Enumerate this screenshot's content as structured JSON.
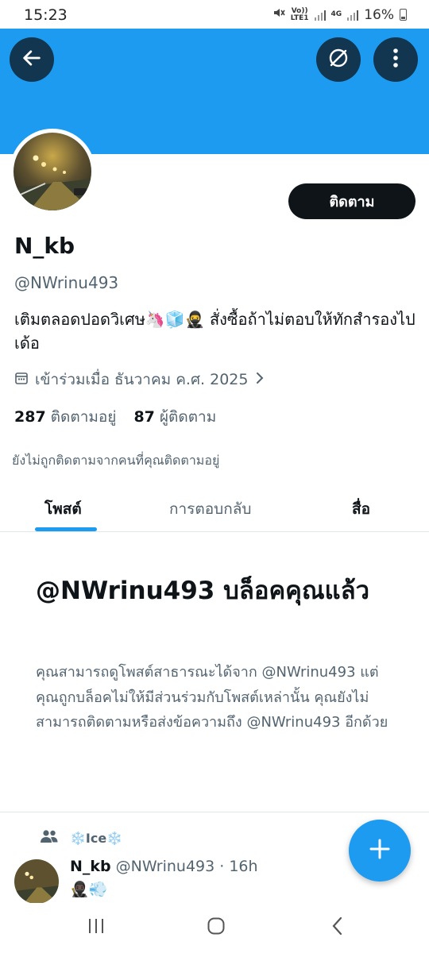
{
  "colors": {
    "banner": "#1d9bf0",
    "accent": "#1d9bf0",
    "text_primary": "#0f1419",
    "text_secondary": "#536471"
  },
  "status_bar": {
    "time": "15:23",
    "volte_top": "Vo))",
    "volte_bottom": "LTE1",
    "network": "4G",
    "battery": "16%"
  },
  "header": {
    "back_icon": "arrow-left-icon",
    "grok_icon": "slash-circle-icon",
    "more_icon": "more-vertical-icon"
  },
  "profile": {
    "display_name": "N_kb",
    "handle": "@NWrinu493",
    "bio": "เติมตลอดปอดวิเศษ🦄🧊🥷 สั่งซื้อถ้าไม่ตอบให้ทักสำรองไปเด้อ",
    "joined": "เข้าร่วมเมื่อ ธันวาคม ค.ศ. 2025",
    "following_count": "287",
    "following_label": "ติดตามอยู่",
    "followers_count": "87",
    "followers_label": "ผู้ติดตาม",
    "not_followed_note": "ยังไม่ถูกติดตามจากคนที่คุณติดตามอยู่",
    "follow_button": "ติดตาม"
  },
  "tabs": [
    {
      "label": "โพสต์",
      "active": true
    },
    {
      "label": "การตอบกลับ",
      "active": false
    },
    {
      "label": "สื่อ",
      "active": false
    }
  ],
  "blocked": {
    "title": "@NWrinu493 บล็อคคุณแล้ว",
    "body": "คุณสามารถดูโพสต์สาธารณะได้จาก @NWrinu493 แต่คุณถูกบล็อคไม่ให้มีส่วนร่วมกับโพสต์เหล่านั้น คุณยังไม่สามารถติดตามหรือส่งข้อความถึง @NWrinu493 อีกด้วย"
  },
  "post": {
    "community_icon": "people-icon",
    "community_name": "❄️Ice❄️",
    "author_name": "N_kb",
    "author_handle": "@NWrinu493",
    "time": "· 16h",
    "text": "🥷🏿💨"
  },
  "fab": {
    "icon": "plus-icon"
  },
  "nav": {
    "recents_icon": "recents-icon",
    "home_icon": "home-icon",
    "back_icon": "back-chevron-icon"
  }
}
